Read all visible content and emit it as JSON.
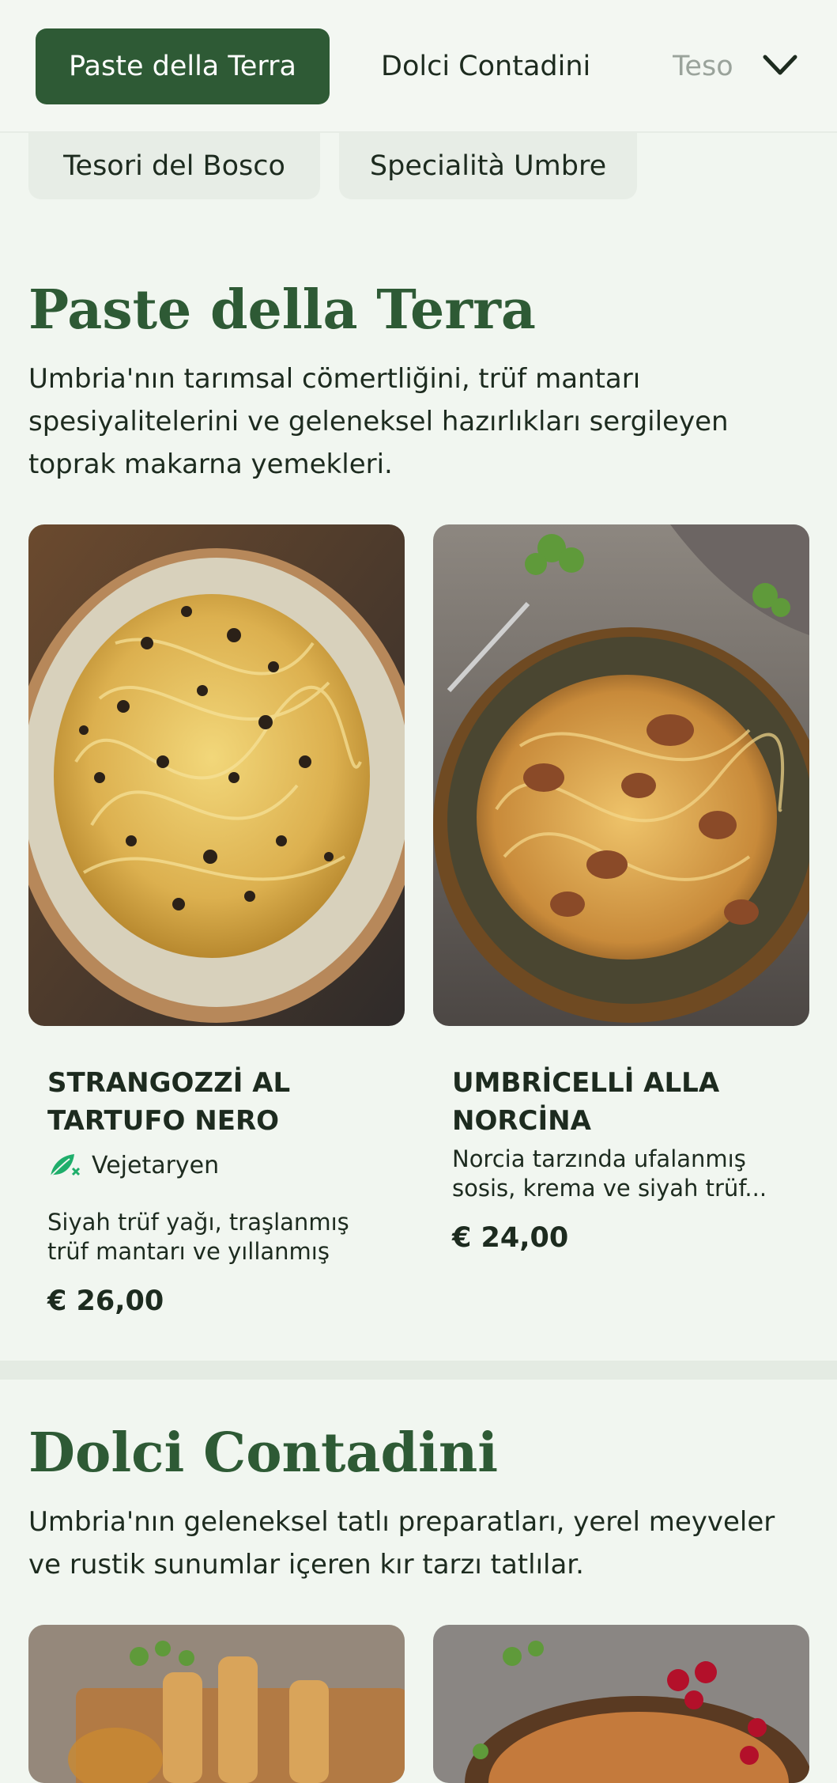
{
  "nav": {
    "tabs": [
      {
        "label": "Paste della Terra",
        "active": true
      },
      {
        "label": "Dolci Contadini",
        "active": false
      },
      {
        "label": "Teso",
        "active": false
      }
    ],
    "more_icon": "chevron-down-icon",
    "sub_tabs": [
      {
        "label": "Tesori del Bosco"
      },
      {
        "label": "Specialità Umbre"
      }
    ]
  },
  "sections": [
    {
      "title": "Paste della Terra",
      "description": "Umbria'nın tarımsal cömertliğini, trüf mantarı spesiyalitelerini ve geleneksel hazırlıkları sergileyen toprak makarna yemekleri.",
      "items": [
        {
          "name": "STRANGOZZİ AL TARTUFO NERO",
          "badge": "Vejetaryen",
          "badge_icon": "vegetarian-leaf-icon",
          "description": "Siyah trüf yağı, traşlanmış trüf mantarı ve yıllanmış Pecorin...",
          "price": "€ 26,00"
        },
        {
          "name": "UMBRİCELLİ ALLA NORCİNA",
          "description": "Norcia tarzında ufalanmış sosis, krema ve siyah trüf...",
          "price": "€ 24,00"
        }
      ]
    },
    {
      "title": "Dolci Contadini",
      "description": "Umbria'nın geleneksel tatlı preparatları, yerel meyveler ve rustik sunumlar içeren kır tarzı tatlılar."
    }
  ],
  "colors": {
    "accent": "#2e5a35",
    "background": "#f1f6f0",
    "vegetarian": "#1fae6b"
  }
}
